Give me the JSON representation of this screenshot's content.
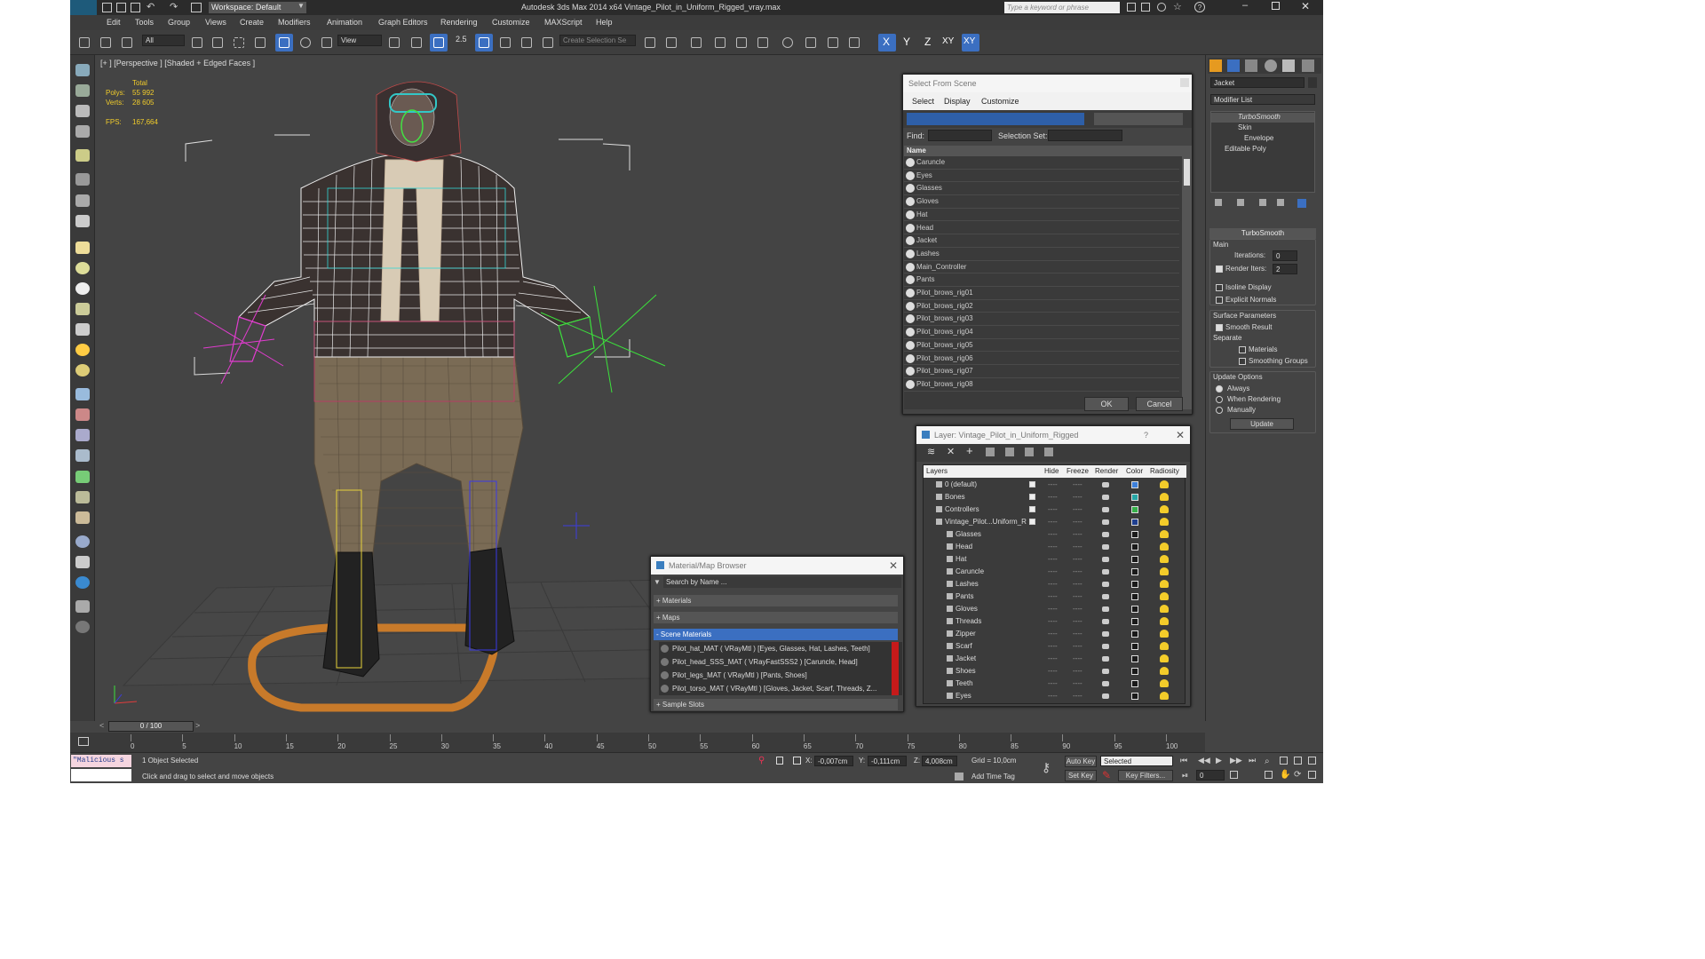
{
  "window": {
    "title": "Autodesk 3ds Max  2014 x64     Vintage_Pilot_in_Uniform_Rigged_vray.max",
    "workspace": "Workspace: Default",
    "search_placeholder": "Type a keyword or phrase"
  },
  "menu": [
    "Edit",
    "Tools",
    "Group",
    "Views",
    "Create",
    "Modifiers",
    "Animation",
    "Graph Editors",
    "Rendering",
    "Customize",
    "MAXScript",
    "Help"
  ],
  "toolbar": {
    "filter": "All",
    "refcoord": "View",
    "snap_angle": "2.5",
    "selection_set_placeholder": "Create Selection Se",
    "axis_buttons": [
      "X",
      "Y",
      "Z",
      "XY",
      "XY"
    ]
  },
  "viewport": {
    "label": "[+ ] [Perspective ] [Shaded + Edged Faces ]",
    "stats": {
      "total_label": "Total",
      "polys_label": "Polys:",
      "polys": "55 992",
      "verts_label": "Verts:",
      "verts": "28 605",
      "fps_label": "FPS:",
      "fps": "167,664"
    }
  },
  "select_from_scene": {
    "title": "Select From Scene",
    "tabs": [
      "Select",
      "Display",
      "Customize"
    ],
    "find_label": "Find:",
    "selection_set_label": "Selection Set:",
    "column_name": "Name",
    "items": [
      "Caruncle",
      "Eyes",
      "Glasses",
      "Gloves",
      "Hat",
      "Head",
      "Jacket",
      "Lashes",
      "Main_Controller",
      "Pants",
      "Pilot_brows_rig01",
      "Pilot_brows_rig02",
      "Pilot_brows_rig03",
      "Pilot_brows_rig04",
      "Pilot_brows_rig05",
      "Pilot_brows_rig06",
      "Pilot_brows_rig07",
      "Pilot_brows_rig08"
    ],
    "ok": "OK",
    "cancel": "Cancel"
  },
  "layer_dialog": {
    "title": "Layer: Vintage_Pilot_in_Uniform_Rigged",
    "help": "?",
    "columns": [
      "Layers",
      "Hide",
      "Freeze",
      "Render",
      "Color",
      "Radiosity"
    ],
    "layers": [
      {
        "name": "0 (default)",
        "indent": 0,
        "color": "#3d7fd9"
      },
      {
        "name": "Bones",
        "indent": 0,
        "color": "#26a6a6"
      },
      {
        "name": "Controllers",
        "indent": 0,
        "color": "#36b04a"
      },
      {
        "name": "Vintage_Pilot...Uniform_R",
        "indent": 0,
        "color": "#1f3f8f"
      },
      {
        "name": "Glasses",
        "indent": 1,
        "color": "#1a1a1a"
      },
      {
        "name": "Head",
        "indent": 1,
        "color": "#1a1a1a"
      },
      {
        "name": "Hat",
        "indent": 1,
        "color": "#1a1a1a"
      },
      {
        "name": "Caruncle",
        "indent": 1,
        "color": "#1a1a1a"
      },
      {
        "name": "Lashes",
        "indent": 1,
        "color": "#1a1a1a"
      },
      {
        "name": "Pants",
        "indent": 1,
        "color": "#1a1a1a"
      },
      {
        "name": "Gloves",
        "indent": 1,
        "color": "#1a1a1a"
      },
      {
        "name": "Threads",
        "indent": 1,
        "color": "#1a1a1a"
      },
      {
        "name": "Zipper",
        "indent": 1,
        "color": "#1a1a1a"
      },
      {
        "name": "Scarf",
        "indent": 1,
        "color": "#1a1a1a"
      },
      {
        "name": "Jacket",
        "indent": 1,
        "color": "#1a1a1a"
      },
      {
        "name": "Shoes",
        "indent": 1,
        "color": "#1a1a1a"
      },
      {
        "name": "Teeth",
        "indent": 1,
        "color": "#1a1a1a"
      },
      {
        "name": "Eyes",
        "indent": 1,
        "color": "#1a1a1a"
      }
    ]
  },
  "material_browser": {
    "title": "Material/Map Browser",
    "search_placeholder": "Search by Name ...",
    "sections": [
      "+ Materials",
      "+ Maps",
      "- Scene Materials",
      "+ Sample Slots"
    ],
    "materials": [
      "Pilot_hat_MAT  ( VRayMtl ) [Eyes, Glasses, Hat, Lashes, Teeth]",
      "Pilot_head_SSS_MAT  ( VRayFastSSS2 ) [Caruncle, Head]",
      "Pilot_legs_MAT  ( VRayMtl ) [Pants, Shoes]",
      "Pilot_torso_MAT  ( VRayMtl ) [Gloves, Jacket, Scarf, Threads, Z..."
    ]
  },
  "command_panel": {
    "object_name": "Jacket",
    "modifier_list": "Modifier List",
    "stack": [
      "TurboSmooth",
      "Skin",
      "Envelope",
      "Editable Poly"
    ],
    "rollout_title": "TurboSmooth",
    "main_label": "Main",
    "iterations_label": "Iterations:",
    "iterations": "0",
    "render_iters_label": "Render Iters:",
    "render_iters": "2",
    "isoline": "Isoline Display",
    "explicit_normals": "Explicit Normals",
    "surface_params": "Surface Parameters",
    "smooth_result": "Smooth Result",
    "separate": "Separate",
    "materials": "Materials",
    "smoothing_groups": "Smoothing Groups",
    "update_options": "Update Options",
    "always": "Always",
    "when_rendering": "When Rendering",
    "manually": "Manually",
    "update_button": "Update"
  },
  "timeline": {
    "frame": "0 / 100",
    "ticks": [
      "0",
      "5",
      "10",
      "15",
      "20",
      "25",
      "30",
      "35",
      "40",
      "45",
      "50",
      "55",
      "60",
      "65",
      "70",
      "75",
      "80",
      "85",
      "90",
      "95",
      "100"
    ]
  },
  "status": {
    "maxscript": "\"Malicious s",
    "selected": "1 Object Selected",
    "prompt": "Click and drag to select and move objects",
    "x_label": "X:",
    "x": "-0,007cm",
    "y_label": "Y:",
    "y": "-0,111cm",
    "z_label": "Z:",
    "z": "4,008cm",
    "grid": "Grid = 10,0cm",
    "add_time_tag": "Add Time Tag",
    "auto_key": "Auto Key",
    "set_key": "Set Key",
    "selected_dropdown": "Selected",
    "key_filters": "Key Filters...",
    "current_frame": "0"
  }
}
